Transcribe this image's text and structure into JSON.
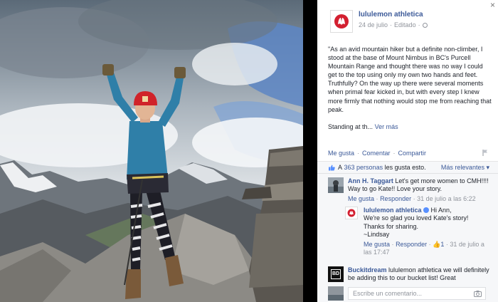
{
  "window": {
    "close_label": "×"
  },
  "post": {
    "page_name": "lululemon athletica",
    "date": "24 de julio",
    "edited": "Editado",
    "body_quote": "\"As an avid mountain hiker but a definite non-climber, I stood at the base of Mount Nimbus in BC's Purcell Mountain Range and thought there was no way I could get to the top using only my own two hands and feet. Truthfully? On the way up there were several moments when primal fear kicked in, but with every step I knew more firmly that nothing would stop me from reaching that peak.",
    "body_tail": "Standing at th...",
    "see_more": "Ver más",
    "logo_icon": "lululemon-logo-icon"
  },
  "actions": {
    "like": "Me gusta",
    "comment": "Comentar",
    "share": "Compartir"
  },
  "likes": {
    "prefix": "A",
    "people": "363 personas",
    "suffix": "les gusta esto.",
    "sort": "Más relevantes"
  },
  "comments": [
    {
      "author": "Ann H. Taggart",
      "text": "Let's get more women to CMH!!!! Way to go Kate!! Love your story.",
      "like": "Me gusta",
      "reply": "Responder",
      "time": "31 de julio a las 6:22"
    },
    {
      "author": "lululemon athletica",
      "line1": "Hi Ann,",
      "line2": "We're so glad you loved Kate's story! Thanks for sharing.",
      "line3": "~Lindsay",
      "like": "Me gusta",
      "reply": "Responder",
      "like_count": "1",
      "time": "31 de julio a las 17:47"
    },
    {
      "author": "Buckitdream",
      "text": "lululemon athletica we will definitely be adding this to our bucket list! Great"
    }
  ],
  "composer": {
    "placeholder": "Escribe un comentario..."
  },
  "colors": {
    "link": "#3b5998",
    "meta": "#90949c",
    "accent": "#5890ff"
  }
}
